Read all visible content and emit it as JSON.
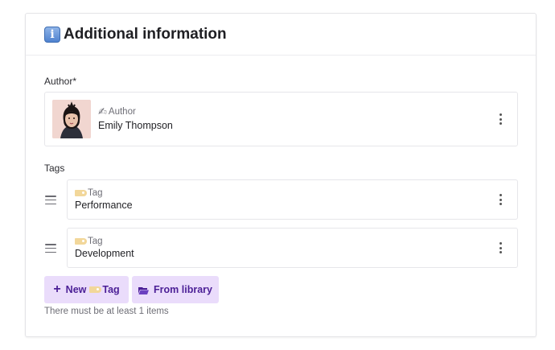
{
  "panel": {
    "title": "Additional information",
    "title_icon": "info-icon"
  },
  "author": {
    "label": "Author*",
    "type_label": "Author",
    "name": "Emily Thompson"
  },
  "tags": {
    "label": "Tags",
    "items": [
      {
        "type_label": "Tag",
        "value": "Performance"
      },
      {
        "type_label": "Tag",
        "value": "Development"
      }
    ],
    "new_button_prefix": "New",
    "new_button_suffix": "Tag",
    "library_button": "From library",
    "hint": "There must be at least 1 items"
  },
  "colors": {
    "accent_bg": "#eadcfb",
    "accent_text": "#4b1f96"
  }
}
